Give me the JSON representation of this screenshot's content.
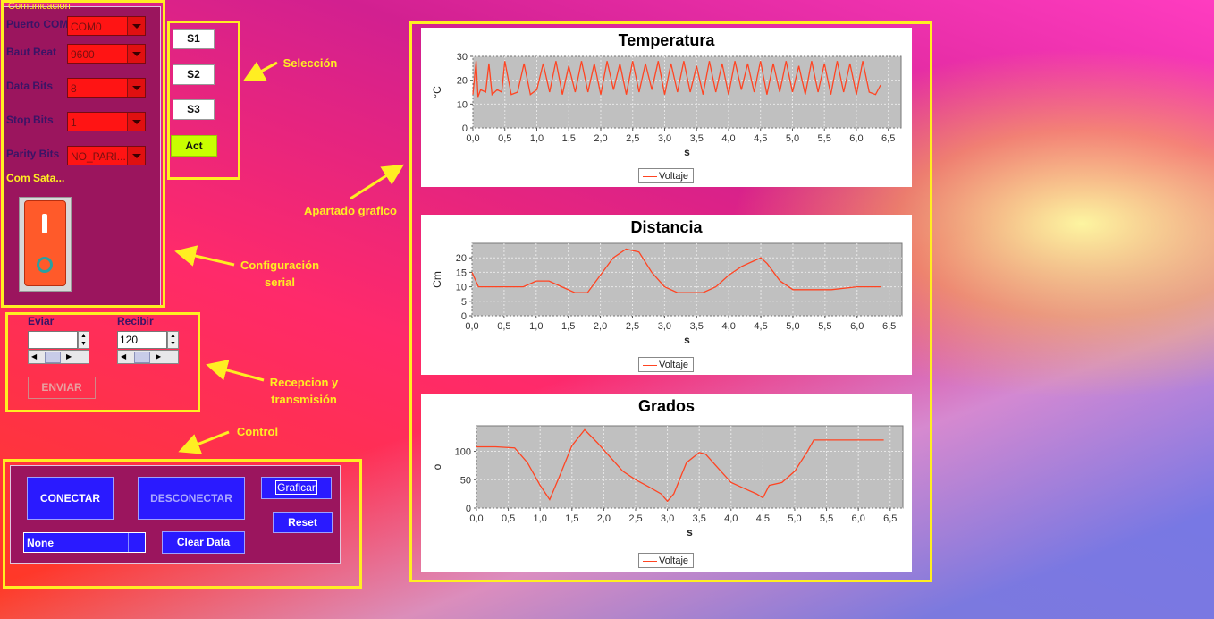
{
  "comunicacion": {
    "legend": "Comunicacion",
    "puerto_label": "Puerto COM",
    "puerto_value": "COM0",
    "baud_label": "Baut Reat",
    "baud_value": "9600",
    "databits_label": "Data Bits",
    "databits_value": "8",
    "stopbits_label": "Stop Bits",
    "stopbits_value": "1",
    "parity_label": "Parity Bits",
    "parity_value": "NO_PARI...",
    "status_label": "Com Sata..."
  },
  "seleccion": {
    "s1": "S1",
    "s2": "S2",
    "s3": "S3",
    "act": "Act"
  },
  "io": {
    "enviar_label": "Eviar",
    "recibir_label": "Recibir",
    "enviar_value": "",
    "recibir_value": "120",
    "enviar_button": "ENVIAR"
  },
  "control": {
    "conectar": "CONECTAR",
    "desconectar": "DESCONECTAR",
    "graficar": "Graficar",
    "reset": "Reset",
    "combo_value": "None",
    "clear": "Clear Data"
  },
  "annotations": {
    "seleccion": "Selección",
    "apartado": "Apartado grafico",
    "config_1": "Configuración",
    "config_2": "serial",
    "recep_1": "Recepcion y",
    "recep_2": "transmisión",
    "control": "Control"
  },
  "colors": {
    "accent_yellow": "#ffee22",
    "series": "#ff4422",
    "panel": "#9b155e",
    "button_blue": "#2a1aff",
    "act_green": "#c8ff00"
  },
  "chart_data": [
    {
      "type": "line",
      "title": "Temperatura",
      "xlabel": "s",
      "ylabel": "°C",
      "xlim": [
        0,
        6.7
      ],
      "ylim": [
        0,
        30
      ],
      "xticks": [
        "0,0",
        "0,5",
        "1,0",
        "1,5",
        "2,0",
        "2,5",
        "3,0",
        "3,5",
        "4,0",
        "4,5",
        "5,0",
        "5,5",
        "6,0",
        "6,5"
      ],
      "yticks": [
        "0",
        "10",
        "20",
        "30"
      ],
      "series": [
        {
          "name": "Voltaje",
          "x": [
            0,
            0.05,
            0.08,
            0.12,
            0.2,
            0.25,
            0.3,
            0.38,
            0.45,
            0.5,
            0.6,
            0.7,
            0.8,
            0.9,
            1.0,
            1.1,
            1.2,
            1.3,
            1.4,
            1.5,
            1.6,
            1.7,
            1.8,
            1.9,
            2.0,
            2.1,
            2.2,
            2.3,
            2.4,
            2.5,
            2.6,
            2.7,
            2.8,
            2.9,
            3.0,
            3.1,
            3.2,
            3.3,
            3.4,
            3.5,
            3.6,
            3.7,
            3.8,
            3.9,
            4.0,
            4.1,
            4.2,
            4.3,
            4.4,
            4.5,
            4.6,
            4.7,
            4.8,
            4.9,
            5.0,
            5.1,
            5.2,
            5.3,
            5.4,
            5.5,
            5.6,
            5.7,
            5.8,
            5.9,
            6.0,
            6.1,
            6.2,
            6.3,
            6.38
          ],
          "values": [
            14,
            28,
            13,
            16,
            15,
            27,
            14,
            16,
            15,
            28,
            14,
            15,
            27,
            14,
            16,
            27,
            15,
            28,
            14,
            26,
            15,
            28,
            15,
            27,
            14,
            28,
            16,
            27,
            14,
            28,
            15,
            27,
            16,
            28,
            14,
            27,
            15,
            28,
            15,
            26,
            14,
            28,
            15,
            27,
            14,
            28,
            16,
            27,
            15,
            28,
            14,
            27,
            15,
            28,
            15,
            26,
            14,
            28,
            15,
            27,
            14,
            28,
            15,
            27,
            14,
            28,
            15,
            14,
            18
          ]
        }
      ],
      "legend": "bottom-center",
      "grid": true
    },
    {
      "type": "line",
      "title": "Distancia",
      "xlabel": "s",
      "ylabel": "Cm",
      "xlim": [
        0,
        6.7
      ],
      "ylim": [
        0,
        25
      ],
      "xticks": [
        "0,0",
        "0,5",
        "1,0",
        "1,5",
        "2,0",
        "2,5",
        "3,0",
        "3,5",
        "4,0",
        "4,5",
        "5,0",
        "5,5",
        "6,0",
        "6,5"
      ],
      "yticks": [
        "0",
        "5",
        "10",
        "15",
        "20"
      ],
      "series": [
        {
          "name": "Voltaje",
          "x": [
            0,
            0.1,
            0.2,
            0.5,
            0.8,
            1.0,
            1.2,
            1.4,
            1.6,
            1.8,
            2.0,
            2.2,
            2.4,
            2.6,
            2.8,
            3.0,
            3.2,
            3.4,
            3.6,
            3.8,
            4.0,
            4.2,
            4.4,
            4.5,
            4.6,
            4.8,
            5.0,
            5.2,
            5.6,
            6.0,
            6.38
          ],
          "values": [
            15,
            10,
            10,
            10,
            10,
            12,
            12,
            10,
            8,
            8,
            14,
            20,
            23,
            22,
            15,
            10,
            8,
            8,
            8,
            10,
            14,
            17,
            19,
            20,
            18,
            12,
            9,
            9,
            9,
            10,
            10
          ]
        }
      ],
      "legend": "bottom-center",
      "grid": true
    },
    {
      "type": "line",
      "title": "Grados",
      "xlabel": "s",
      "ylabel": "o",
      "xlim": [
        0,
        6.7
      ],
      "ylim": [
        0,
        145
      ],
      "xticks": [
        "0,0",
        "0,5",
        "1,0",
        "1,5",
        "2,0",
        "2,5",
        "3,0",
        "3,5",
        "4,0",
        "4,5",
        "5,0",
        "5,5",
        "6,0",
        "6,5"
      ],
      "yticks": [
        "0",
        "50",
        "100"
      ],
      "series": [
        {
          "name": "Voltaje",
          "x": [
            0,
            0.3,
            0.6,
            0.8,
            1.0,
            1.15,
            1.3,
            1.5,
            1.7,
            1.9,
            2.1,
            2.3,
            2.5,
            2.7,
            2.9,
            3.0,
            3.1,
            3.3,
            3.5,
            3.6,
            3.8,
            4.0,
            4.2,
            4.4,
            4.5,
            4.6,
            4.8,
            5.0,
            5.2,
            5.3,
            5.6,
            6.0,
            6.4
          ],
          "values": [
            108,
            108,
            106,
            80,
            40,
            15,
            55,
            110,
            138,
            115,
            90,
            65,
            50,
            38,
            25,
            12,
            25,
            80,
            98,
            95,
            70,
            45,
            35,
            25,
            18,
            40,
            45,
            65,
            100,
            120,
            120,
            120,
            120
          ]
        }
      ],
      "legend": "bottom-center",
      "grid": true
    }
  ]
}
